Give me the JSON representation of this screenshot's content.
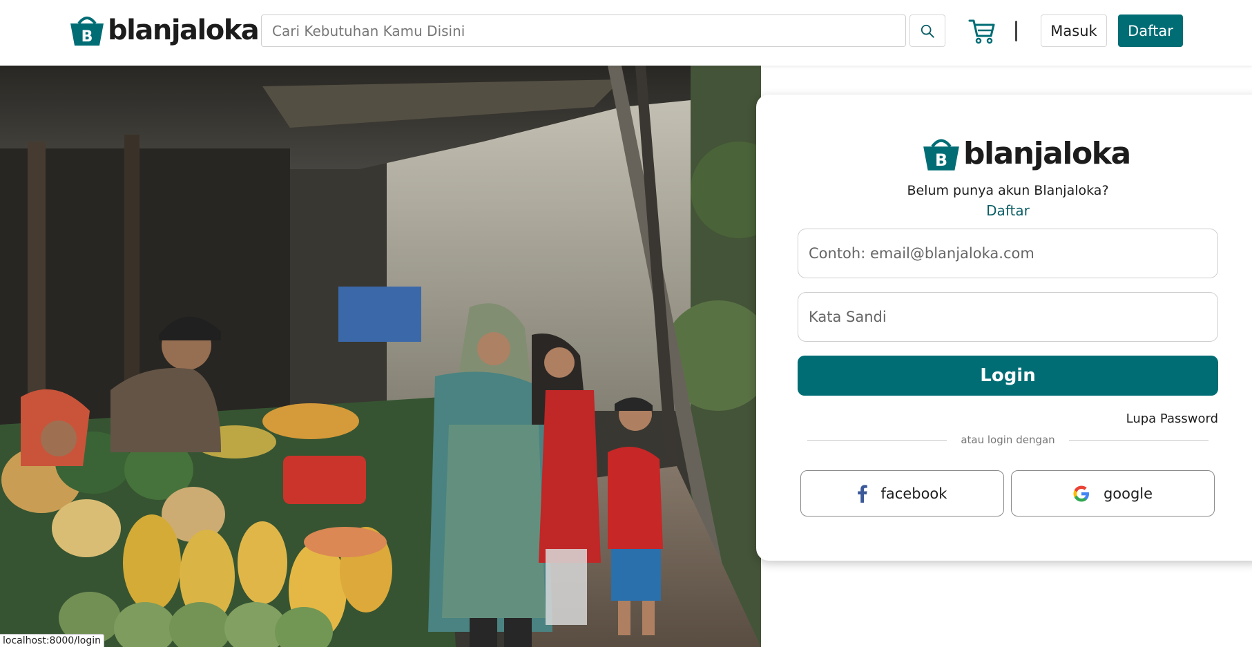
{
  "brand": {
    "name": "blanjaloka",
    "badge_letter": "B",
    "primary_color": "#006d75"
  },
  "header": {
    "search": {
      "placeholder": "Cari Kebutuhan Kamu Disini",
      "value": ""
    },
    "search_icon": "search-icon",
    "cart_icon": "shopping-cart-icon",
    "login_label": "Masuk",
    "register_label": "Daftar"
  },
  "login": {
    "prompt": "Belum punya akun Blanjaloka?",
    "register_link": "Daftar",
    "email_placeholder": "Contoh: email@blanjaloka.com",
    "password_placeholder": "Kata Sandi",
    "submit_label": "Login",
    "forgot_label": "Lupa Password",
    "divider_text": "atau login dengan",
    "facebook_label": "facebook",
    "google_label": "google"
  },
  "status_bar": {
    "url": "localhost:8000/login"
  }
}
